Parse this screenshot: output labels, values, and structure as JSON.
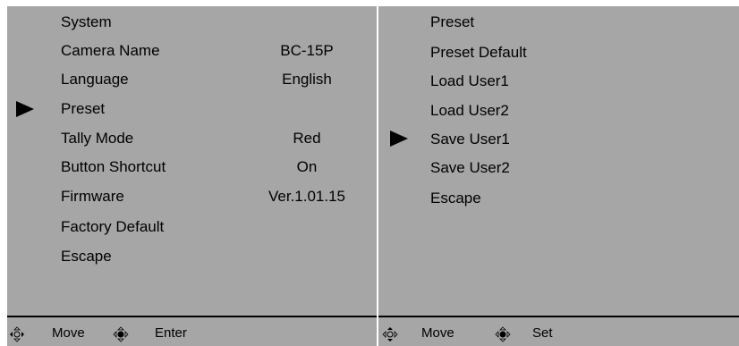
{
  "left_menu": {
    "title": "System",
    "items": [
      {
        "label": "Camera Name",
        "value": "BC-15P"
      },
      {
        "label": "Language",
        "value": "English"
      },
      {
        "label": "Preset",
        "value": ""
      },
      {
        "label": "Tally Mode",
        "value": "Red"
      },
      {
        "label": "Button Shortcut",
        "value": "On"
      },
      {
        "label": "Firmware",
        "value": "Ver.1.01.15"
      },
      {
        "label": "Factory Default",
        "value": ""
      },
      {
        "label": "Escape",
        "value": ""
      }
    ],
    "selected_index": 2,
    "footer": {
      "move_label": "Move",
      "action_label": "Enter"
    }
  },
  "right_menu": {
    "title": "Preset",
    "items": [
      {
        "label": "Preset Default"
      },
      {
        "label": "Load User1"
      },
      {
        "label": "Load User2"
      },
      {
        "label": "Save User1"
      },
      {
        "label": "Save User2"
      },
      {
        "label": "Escape"
      }
    ],
    "selected_index": 3,
    "footer": {
      "move_label": "Move",
      "action_label": "Set"
    }
  },
  "icons": {
    "move": "dpad-left-right-icon",
    "action": "dpad-center-press-icon"
  },
  "colors": {
    "panel_background": "#a6a6a6",
    "text": "#000000",
    "page_background": "#ffffff"
  }
}
